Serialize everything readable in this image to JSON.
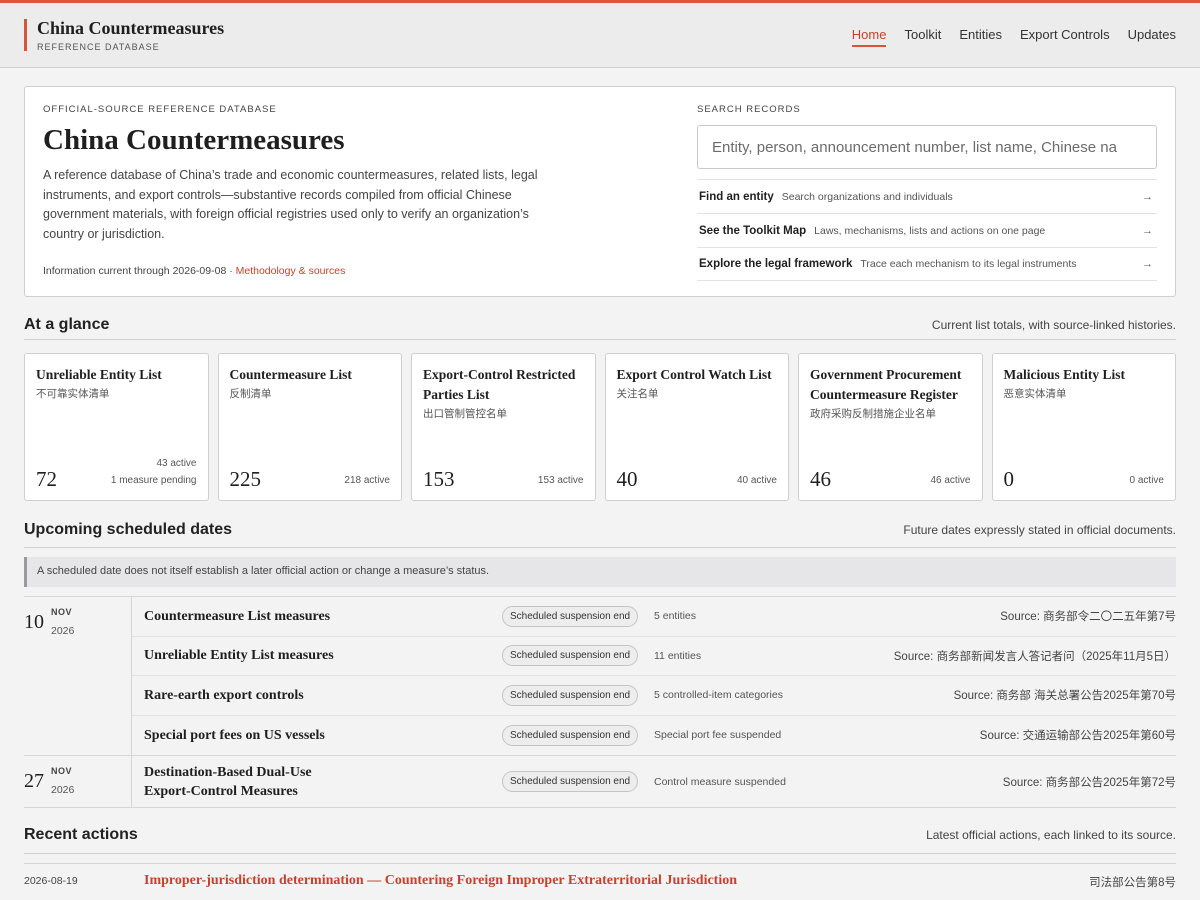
{
  "brand": {
    "title": "China Countermeasures",
    "subtitle": "REFERENCE DATABASE"
  },
  "nav": [
    {
      "label": "Home",
      "active": true
    },
    {
      "label": "Toolkit"
    },
    {
      "label": "Entities"
    },
    {
      "label": "Export Controls"
    },
    {
      "label": "Updates"
    }
  ],
  "hero": {
    "kicker": "OFFICIAL-SOURCE REFERENCE DATABASE",
    "title": "China Countermeasures",
    "description": "A reference database of China’s trade and economic countermeasures, related lists, legal instruments, and export controls—substantive records compiled from official Chinese government materials, with foreign official registries used only to verify an organization’s country or jurisdiction.",
    "meta_prefix": "Information current through 2026-09-08 · ",
    "meta_link": "Methodology & sources"
  },
  "search": {
    "label": "SEARCH RECORDS",
    "placeholder": "Entity, person, announcement number, list name, Chinese na",
    "quick_links": [
      {
        "title": "Find an entity",
        "desc": "Search organizations and individuals"
      },
      {
        "title": "See the Toolkit Map",
        "desc": "Laws, mechanisms, lists and actions on one page"
      },
      {
        "title": "Explore the legal framework",
        "desc": "Trace each mechanism to its legal instruments"
      }
    ],
    "arrow": "→"
  },
  "glance": {
    "title": "At a glance",
    "note": "Current list totals, with source-linked histories.",
    "cards": [
      {
        "name": "Unreliable Entity List",
        "zh": "不可靠实体清单",
        "count": "72",
        "active": "43 active",
        "extra": "1 measure pending"
      },
      {
        "name": "Countermeasure List",
        "zh": "反制清单",
        "count": "225",
        "active": "218 active",
        "extra": ""
      },
      {
        "name": "Export-Control Restricted Parties List",
        "zh": "出口管制管控名单",
        "count": "153",
        "active": "153 active",
        "extra": ""
      },
      {
        "name": "Export Control Watch List",
        "zh": "关注名单",
        "count": "40",
        "active": "40 active",
        "extra": ""
      },
      {
        "name": "Government Procurement Countermeasure Register",
        "zh": "政府采购反制措施企业名单",
        "count": "46",
        "active": "46 active",
        "extra": ""
      },
      {
        "name": "Malicious Entity List",
        "zh": "恶意实体清单",
        "count": "0",
        "active": "0 active",
        "extra": ""
      }
    ]
  },
  "upcoming": {
    "title": "Upcoming scheduled dates",
    "note": "Future dates expressly stated in official documents.",
    "notice": "A scheduled date does not itself establish a later official action or change a measure’s status.",
    "groups": [
      {
        "day": "10",
        "month": "NOV",
        "year": "2026",
        "rows": [
          {
            "title": "Countermeasure List measures",
            "pill": "Scheduled suspension end",
            "detail": "5 entities",
            "source": "Source: 商务部令二〇二五年第7号"
          },
          {
            "title": "Unreliable Entity List measures",
            "pill": "Scheduled suspension end",
            "detail": "11 entities",
            "source": "Source: 商务部新闻发言人答记者问（2025年11月5日）"
          },
          {
            "title": "Rare-earth export controls",
            "pill": "Scheduled suspension end",
            "detail": "5 controlled-item categories",
            "source": "Source: 商务部 海关总署公告2025年第70号"
          },
          {
            "title": "Special port fees on US vessels",
            "pill": "Scheduled suspension end",
            "detail": "Special port fee suspended",
            "source": "Source: 交通运输部公告2025年第60号"
          }
        ]
      },
      {
        "day": "27",
        "month": "NOV",
        "year": "2026",
        "rows": [
          {
            "title": "Destination-Based Dual-Use Export-Control Measures",
            "pill": "Scheduled suspension end",
            "detail": "Control measure suspended",
            "source": "Source: 商务部公告2025年第72号"
          }
        ]
      }
    ]
  },
  "recent": {
    "title": "Recent actions",
    "note": "Latest official actions, each linked to its source.",
    "items": [
      {
        "date": "2026-08-19",
        "title": "Improper-jurisdiction determination — Countering Foreign Improper Extraterritorial Jurisdiction",
        "source": "司法部公告第8号"
      }
    ]
  }
}
